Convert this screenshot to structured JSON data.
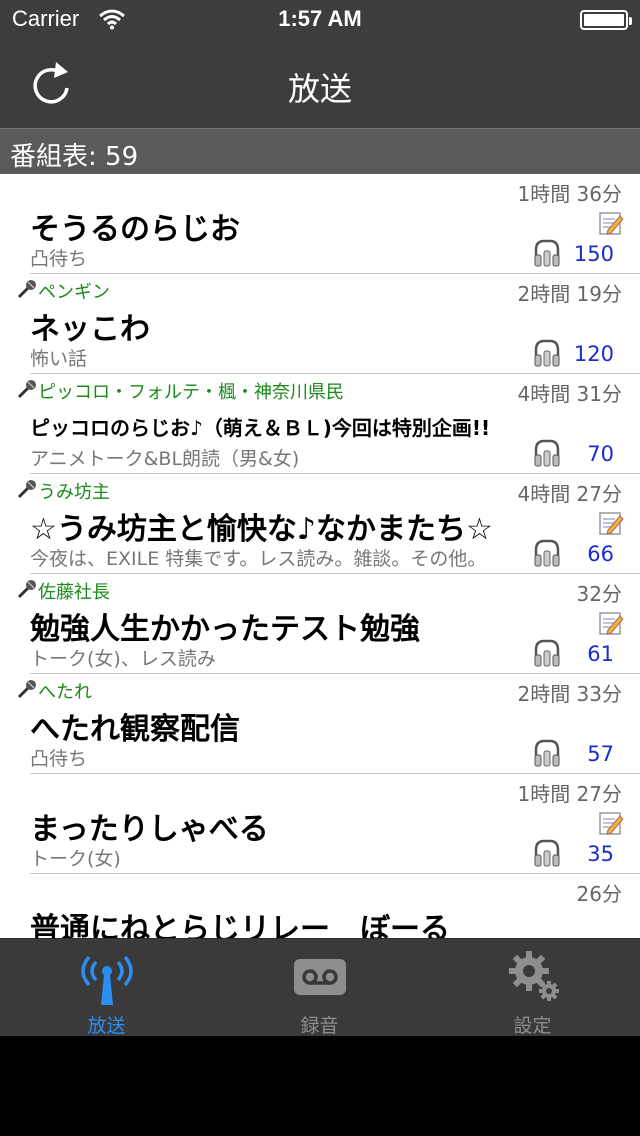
{
  "status_bar": {
    "carrier": "Carrier",
    "time": "1:57 AM"
  },
  "nav": {
    "title": "放送"
  },
  "section": {
    "header": "番組表: 59"
  },
  "programs": [
    {
      "user": "",
      "duration": "1時間 36分",
      "title": "そうるのらじお",
      "subtitle": "凸待ち",
      "listeners": "150",
      "has_memo": true,
      "has_mic": false
    },
    {
      "user": "ペンギン",
      "duration": "2時間 19分",
      "title": "ネッこわ",
      "subtitle": "怖い話",
      "listeners": "120",
      "has_memo": false,
      "has_mic": true
    },
    {
      "user": "ピッコロ・フォルテ・楓・神奈川県民",
      "duration": "4時間 31分",
      "title": "ピッコロのらじお♪（萌え＆ＢＬ)今回は特別企画!!",
      "subtitle": "アニメトーク&BL朗読（男&女)",
      "listeners": "70",
      "has_memo": false,
      "has_mic": true
    },
    {
      "user": "うみ坊主",
      "duration": "4時間 27分",
      "title": "☆うみ坊主と愉快な♪なかまたち☆",
      "subtitle": "今夜は、EXILE 特集です。レス読み。雑談。その他。",
      "listeners": "66",
      "has_memo": true,
      "has_mic": true
    },
    {
      "user": "佐藤社長",
      "duration": "32分",
      "title": "勉強人生かかったテスト勉強",
      "subtitle": "トーク(女)、レス読み",
      "listeners": "61",
      "has_memo": true,
      "has_mic": true
    },
    {
      "user": "へたれ",
      "duration": "2時間 33分",
      "title": "へたれ観察配信",
      "subtitle": "凸待ち",
      "listeners": "57",
      "has_memo": false,
      "has_mic": true
    },
    {
      "user": "",
      "duration": "1時間 27分",
      "title": "まったりしゃべる",
      "subtitle": "トーク(女)",
      "listeners": "35",
      "has_memo": true,
      "has_mic": false
    },
    {
      "user": "",
      "duration": "26分",
      "title": "普通にねとらじリレー　ぼーる",
      "subtitle": "",
      "listeners": "",
      "has_memo": false,
      "has_mic": false
    }
  ],
  "tabs": [
    {
      "label": "放送",
      "icon": "broadcast-icon",
      "active": true
    },
    {
      "label": "録音",
      "icon": "voicemail-icon",
      "active": false
    },
    {
      "label": "設定",
      "icon": "gear-icon",
      "active": false
    }
  ],
  "colors": {
    "bar": "#3d3d3d",
    "section": "#5a5a5a",
    "user_name": "#1a8a1a",
    "listener_count": "#1a2ccf",
    "tab_active": "#2a8ff0"
  }
}
